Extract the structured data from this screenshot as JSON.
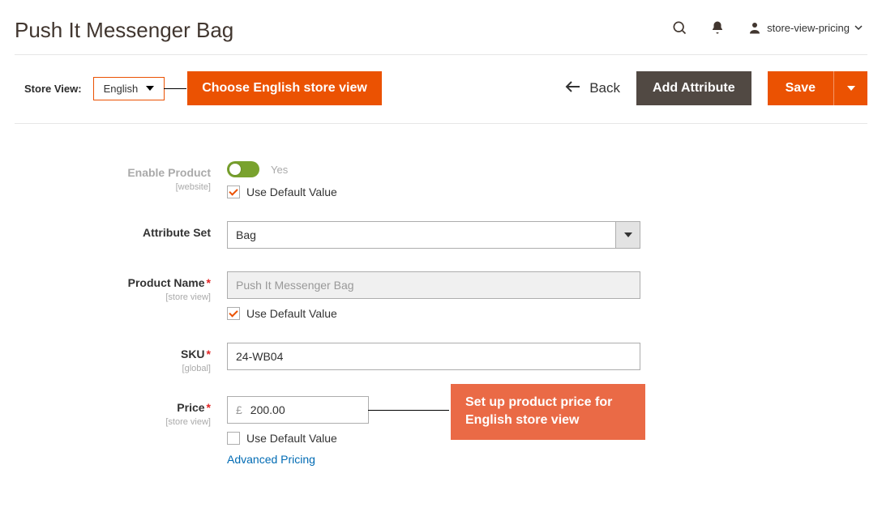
{
  "header": {
    "title": "Push It Messenger Bag",
    "user_label": "store-view-pricing"
  },
  "toolbar": {
    "store_view_label": "Store View:",
    "store_view_value": "English",
    "callout_store_view": "Choose English store view",
    "back_label": "Back",
    "add_attribute_label": "Add Attribute",
    "save_label": "Save"
  },
  "fields": {
    "enable_product": {
      "label": "Enable Product",
      "scope": "[website]",
      "value_text": "Yes",
      "use_default_label": "Use Default Value"
    },
    "attribute_set": {
      "label": "Attribute Set",
      "value": "Bag"
    },
    "product_name": {
      "label": "Product Name",
      "scope": "[store view]",
      "value": "Push It Messenger Bag",
      "use_default_label": "Use Default Value"
    },
    "sku": {
      "label": "SKU",
      "scope": "[global]",
      "value": "24-WB04"
    },
    "price": {
      "label": "Price",
      "scope": "[store view]",
      "currency": "£",
      "value": "200.00",
      "use_default_label": "Use Default Value",
      "advanced_label": "Advanced Pricing",
      "callout_price": "Set up product price for English store view"
    }
  }
}
